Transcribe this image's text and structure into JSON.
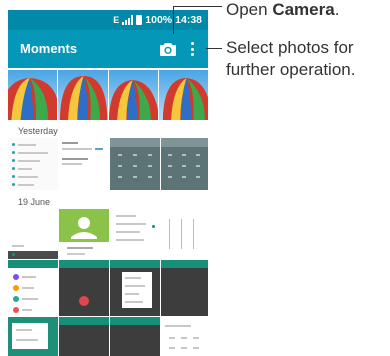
{
  "status": {
    "network": "E",
    "battery": "100%",
    "time": "14:38",
    "bar_color": "#0288a8"
  },
  "appbar": {
    "title": "Moments",
    "color": "#0497b8",
    "camera_icon": "camera-icon",
    "more_icon": "more-vertical-icon"
  },
  "sections": [
    {
      "label": "Yesterday"
    },
    {
      "label": "19 June"
    }
  ],
  "callouts": {
    "camera": {
      "prefix": "Open ",
      "bold": "Camera",
      "suffix": "."
    },
    "select": {
      "line1": "Select photos for",
      "line2": "further operation."
    }
  }
}
